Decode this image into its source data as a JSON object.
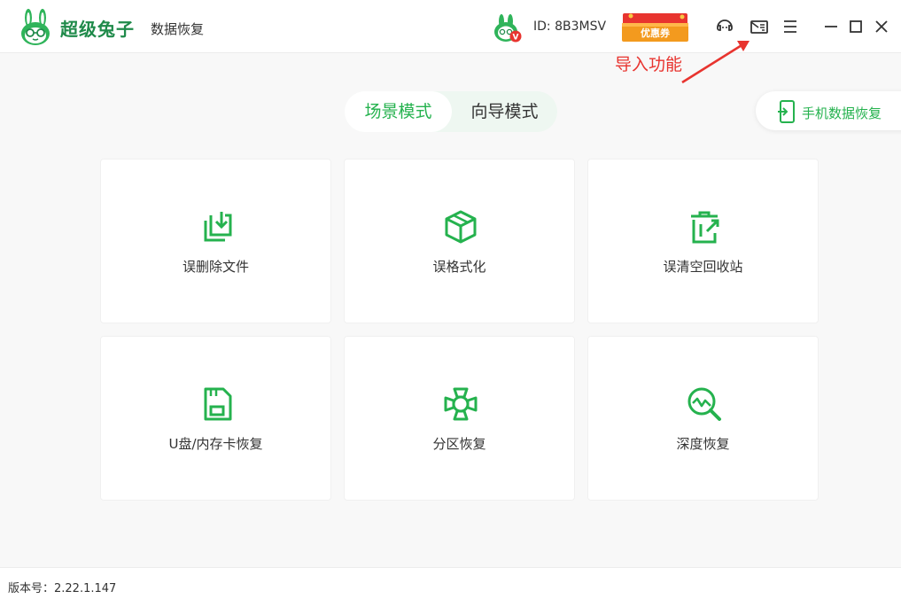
{
  "app": {
    "brand_name": "超级兔子",
    "brand_sub": "数据恢复"
  },
  "user": {
    "id_label": "ID: 8B3MSV",
    "vip_badge": "V"
  },
  "coupon": {
    "label": "优惠券"
  },
  "toolbar": {
    "icons": [
      "support-icon",
      "import-icon",
      "menu-icon",
      "minimize-icon",
      "maximize-icon",
      "close-icon"
    ]
  },
  "annotation": {
    "text": "导入功能"
  },
  "modes": {
    "active": "场景模式",
    "inactive": "向导模式"
  },
  "phone_recovery": {
    "label": "手机数据恢复"
  },
  "cards": [
    {
      "label": "误删除文件",
      "icon": "delete-file-icon"
    },
    {
      "label": "误格式化",
      "icon": "format-box-icon"
    },
    {
      "label": "误清空回收站",
      "icon": "recycle-bin-icon"
    },
    {
      "label": "U盘/内存卡恢复",
      "icon": "sd-card-icon"
    },
    {
      "label": "分区恢复",
      "icon": "partition-icon"
    },
    {
      "label": "深度恢复",
      "icon": "deep-search-icon"
    }
  ],
  "footer": {
    "version": "版本号：2.22.1.147"
  },
  "colors": {
    "accent": "#25b24e",
    "annotation": "#e8342f",
    "coupon": "#f08a1c"
  }
}
